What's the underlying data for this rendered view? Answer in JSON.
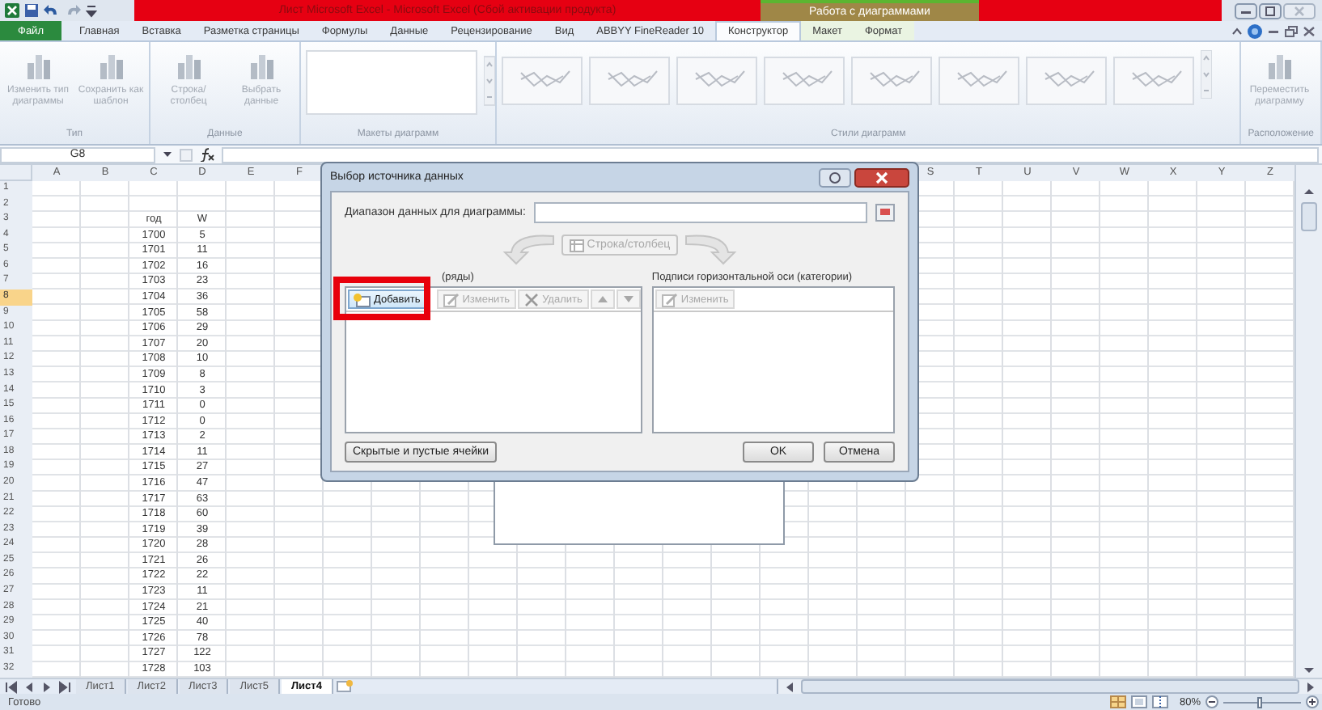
{
  "title_bar": {
    "title": "Лист Microsoft Excel - Microsoft Excel (Сбой активации продукта)",
    "context_label": "Работа с диаграммами"
  },
  "ribbon_tabs": [
    {
      "label": "Файл",
      "kind": "file",
      "selected": false
    },
    {
      "label": "Главная",
      "kind": "tab",
      "selected": false
    },
    {
      "label": "Вставка",
      "kind": "tab",
      "selected": false
    },
    {
      "label": "Разметка страницы",
      "kind": "tab",
      "selected": false
    },
    {
      "label": "Формулы",
      "kind": "tab",
      "selected": false
    },
    {
      "label": "Данные",
      "kind": "tab",
      "selected": false
    },
    {
      "label": "Рецензирование",
      "kind": "tab",
      "selected": false
    },
    {
      "label": "Вид",
      "kind": "tab",
      "selected": false
    },
    {
      "label": "ABBYY FineReader 10",
      "kind": "tab",
      "selected": false
    },
    {
      "label": "Конструктор",
      "kind": "context",
      "selected": true
    },
    {
      "label": "Макет",
      "kind": "context",
      "selected": false
    },
    {
      "label": "Формат",
      "kind": "context",
      "selected": false
    }
  ],
  "ribbon_groups": [
    {
      "kind": "buttons",
      "label": "Тип",
      "buttons": [
        {
          "label": "Изменить тип диаграммы",
          "disabled": true
        },
        {
          "label": "Сохранить как шаблон",
          "disabled": true
        }
      ]
    },
    {
      "kind": "buttons",
      "label": "Данные",
      "buttons": [
        {
          "label": "Строка/столбец",
          "disabled": true
        },
        {
          "label": "Выбрать данные",
          "disabled": true
        }
      ]
    },
    {
      "kind": "layouts",
      "label": "Макеты диаграмм"
    },
    {
      "kind": "styles",
      "label": "Стили диаграмм"
    },
    {
      "kind": "buttons",
      "label": "Расположение",
      "buttons": [
        {
          "label": "Переместить диаграмму",
          "disabled": true
        }
      ]
    }
  ],
  "formula_bar": {
    "name_box": "G8"
  },
  "sheet": {
    "columns_left": [
      "A",
      "B",
      "C",
      "D",
      "E",
      "F"
    ],
    "columns_right": [
      "S",
      "T",
      "U",
      "V",
      "W",
      "X",
      "Y",
      "Z"
    ],
    "rows": [
      {
        "number": "1",
        "selected": false
      },
      {
        "number": "2",
        "selected": false
      },
      {
        "number": "3",
        "selected": false,
        "cells": [
          "год",
          "W"
        ]
      },
      {
        "number": "4",
        "selected": false,
        "cells": [
          "1700",
          "5"
        ]
      },
      {
        "number": "5",
        "selected": false,
        "cells": [
          "1701",
          "11"
        ]
      },
      {
        "number": "6",
        "selected": false,
        "cells": [
          "1702",
          "16"
        ]
      },
      {
        "number": "7",
        "selected": false,
        "cells": [
          "1703",
          "23"
        ]
      },
      {
        "number": "8",
        "selected": true,
        "cells": [
          "1704",
          "36"
        ]
      },
      {
        "number": "9",
        "selected": false,
        "cells": [
          "1705",
          "58"
        ]
      },
      {
        "number": "10",
        "selected": false,
        "cells": [
          "1706",
          "29"
        ]
      },
      {
        "number": "11",
        "selected": false,
        "cells": [
          "1707",
          "20"
        ]
      },
      {
        "number": "12",
        "selected": false,
        "cells": [
          "1708",
          "10"
        ]
      },
      {
        "number": "13",
        "selected": false,
        "cells": [
          "1709",
          "8"
        ]
      },
      {
        "number": "14",
        "selected": false,
        "cells": [
          "1710",
          "3"
        ]
      },
      {
        "number": "15",
        "selected": false,
        "cells": [
          "1711",
          "0"
        ]
      },
      {
        "number": "16",
        "selected": false,
        "cells": [
          "1712",
          "0"
        ]
      },
      {
        "number": "17",
        "selected": false,
        "cells": [
          "1713",
          "2"
        ]
      },
      {
        "number": "18",
        "selected": false,
        "cells": [
          "1714",
          "11"
        ]
      },
      {
        "number": "19",
        "selected": false,
        "cells": [
          "1715",
          "27"
        ]
      },
      {
        "number": "20",
        "selected": false,
        "cells": [
          "1716",
          "47"
        ]
      },
      {
        "number": "21",
        "selected": false,
        "cells": [
          "1717",
          "63"
        ]
      },
      {
        "number": "22",
        "selected": false,
        "cells": [
          "1718",
          "60"
        ]
      },
      {
        "number": "23",
        "selected": false,
        "cells": [
          "1719",
          "39"
        ]
      },
      {
        "number": "24",
        "selected": false,
        "cells": [
          "1720",
          "28"
        ]
      },
      {
        "number": "25",
        "selected": false,
        "cells": [
          "1721",
          "26"
        ]
      },
      {
        "number": "26",
        "selected": false,
        "cells": [
          "1722",
          "22"
        ]
      },
      {
        "number": "27",
        "selected": false,
        "cells": [
          "1723",
          "11"
        ]
      },
      {
        "number": "28",
        "selected": false,
        "cells": [
          "1724",
          "21"
        ]
      },
      {
        "number": "29",
        "selected": false,
        "cells": [
          "1725",
          "40"
        ]
      },
      {
        "number": "30",
        "selected": false,
        "cells": [
          "1726",
          "78"
        ]
      },
      {
        "number": "31",
        "selected": false,
        "cells": [
          "1727",
          "122"
        ]
      },
      {
        "number": "32",
        "selected": false,
        "cells": [
          "1728",
          "103"
        ]
      }
    ]
  },
  "sheet_tabs": [
    {
      "label": "Лист1",
      "selected": false
    },
    {
      "label": "Лист2",
      "selected": false
    },
    {
      "label": "Лист3",
      "selected": false
    },
    {
      "label": "Лист5",
      "selected": false
    },
    {
      "label": "Лист4",
      "selected": true
    }
  ],
  "status_bar": {
    "text": "Готово",
    "zoom": "80%",
    "zoom_slider": {
      "level": 0.45
    }
  },
  "dialog": {
    "title": "Выбор источника данных",
    "range_label": "Диапазон данных для диаграммы:",
    "switch_button": {
      "label": "Строка/столбец",
      "disabled": true
    },
    "series_panel": {
      "label": "(ряды)",
      "highlighted": true,
      "buttons": [
        {
          "kind": "add",
          "label": "Добавить",
          "disabled": false
        },
        {
          "kind": "edit",
          "label": "Изменить",
          "disabled": true
        },
        {
          "kind": "delete",
          "label": "Удалить",
          "disabled": true
        },
        {
          "kind": "up",
          "disabled": true
        },
        {
          "kind": "down",
          "disabled": true
        }
      ]
    },
    "category_panel": {
      "label": "Подписи горизонтальной оси (категории)",
      "buttons": [
        {
          "kind": "edit",
          "label": "Изменить",
          "disabled": true
        }
      ]
    },
    "hidden_cells_button": "Скрытые и пустые ячейки",
    "ok_button": "OK",
    "cancel_button": "Отмена"
  }
}
